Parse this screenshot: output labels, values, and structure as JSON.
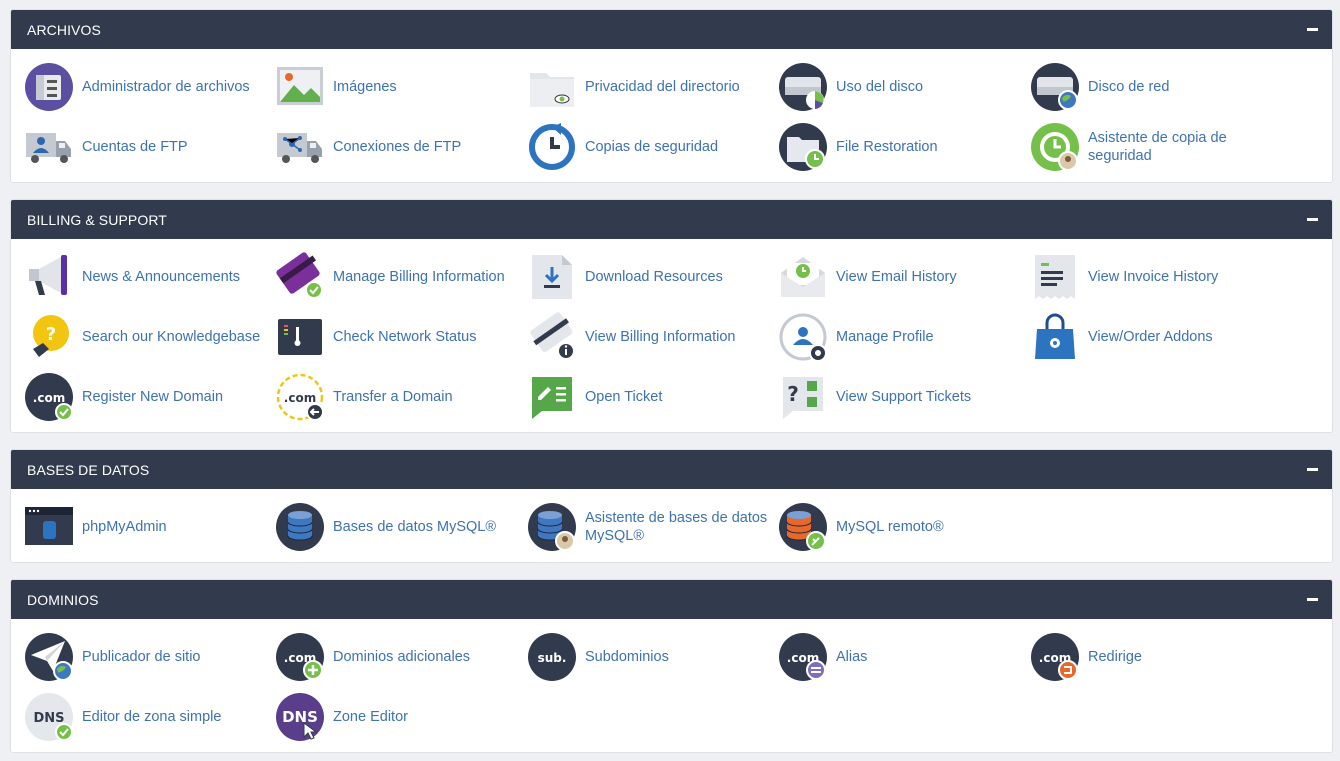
{
  "sections": [
    {
      "title": "ARCHIVOS",
      "items": [
        {
          "label": "Administrador de archivos",
          "icon": "file-manager-icon"
        },
        {
          "label": "Imágenes",
          "icon": "images-icon"
        },
        {
          "label": "Privacidad del directorio",
          "icon": "directory-privacy-icon"
        },
        {
          "label": "Uso del disco",
          "icon": "disk-usage-icon"
        },
        {
          "label": "Disco de red",
          "icon": "web-disk-icon"
        },
        {
          "label": "Cuentas de FTP",
          "icon": "ftp-accounts-icon"
        },
        {
          "label": "Conexiones de FTP",
          "icon": "ftp-connections-icon"
        },
        {
          "label": "Copias de seguridad",
          "icon": "backup-icon"
        },
        {
          "label": "File Restoration",
          "icon": "file-restoration-icon"
        },
        {
          "label": "Asistente de copia de seguridad",
          "icon": "backup-wizard-icon"
        }
      ]
    },
    {
      "title": "BILLING & SUPPORT",
      "items": [
        {
          "label": "News & Announcements",
          "icon": "megaphone-icon"
        },
        {
          "label": "Manage Billing Information",
          "icon": "credit-card-check-icon"
        },
        {
          "label": "Download Resources",
          "icon": "download-document-icon"
        },
        {
          "label": "View Email History",
          "icon": "email-history-icon"
        },
        {
          "label": "View Invoice History",
          "icon": "invoice-icon"
        },
        {
          "label": "Search our Knowledgebase",
          "icon": "lightbulb-question-icon"
        },
        {
          "label": "Check Network Status",
          "icon": "network-status-icon"
        },
        {
          "label": "View Billing Information",
          "icon": "billing-info-icon"
        },
        {
          "label": "Manage Profile",
          "icon": "profile-gear-icon"
        },
        {
          "label": "View/Order Addons",
          "icon": "shopping-bag-icon"
        },
        {
          "label": "Register New Domain",
          "icon": "register-domain-icon"
        },
        {
          "label": "Transfer a Domain",
          "icon": "transfer-domain-icon"
        },
        {
          "label": "Open Ticket",
          "icon": "open-ticket-icon"
        },
        {
          "label": "View Support Tickets",
          "icon": "support-tickets-icon"
        }
      ]
    },
    {
      "title": "BASES DE DATOS",
      "items": [
        {
          "label": "phpMyAdmin",
          "icon": "phpmyadmin-icon"
        },
        {
          "label": "Bases de datos MySQL®",
          "icon": "mysql-databases-icon"
        },
        {
          "label": "Asistente de bases de datos MySQL®",
          "icon": "mysql-wizard-icon"
        },
        {
          "label": "MySQL remoto®",
          "icon": "remote-mysql-icon"
        }
      ]
    },
    {
      "title": "DOMINIOS",
      "items": [
        {
          "label": "Publicador de sitio",
          "icon": "site-publisher-icon"
        },
        {
          "label": "Dominios adicionales",
          "icon": "addon-domains-icon"
        },
        {
          "label": "Subdominios",
          "icon": "subdomains-icon"
        },
        {
          "label": "Alias",
          "icon": "aliases-icon"
        },
        {
          "label": "Redirige",
          "icon": "redirects-icon"
        },
        {
          "label": "Editor de zona simple",
          "icon": "simple-zone-editor-icon"
        },
        {
          "label": "Zone Editor",
          "icon": "zone-editor-icon"
        }
      ]
    }
  ],
  "colors": {
    "header_bg": "#323b4e",
    "link": "#3e72b0",
    "page_bg": "#eef0f3"
  }
}
